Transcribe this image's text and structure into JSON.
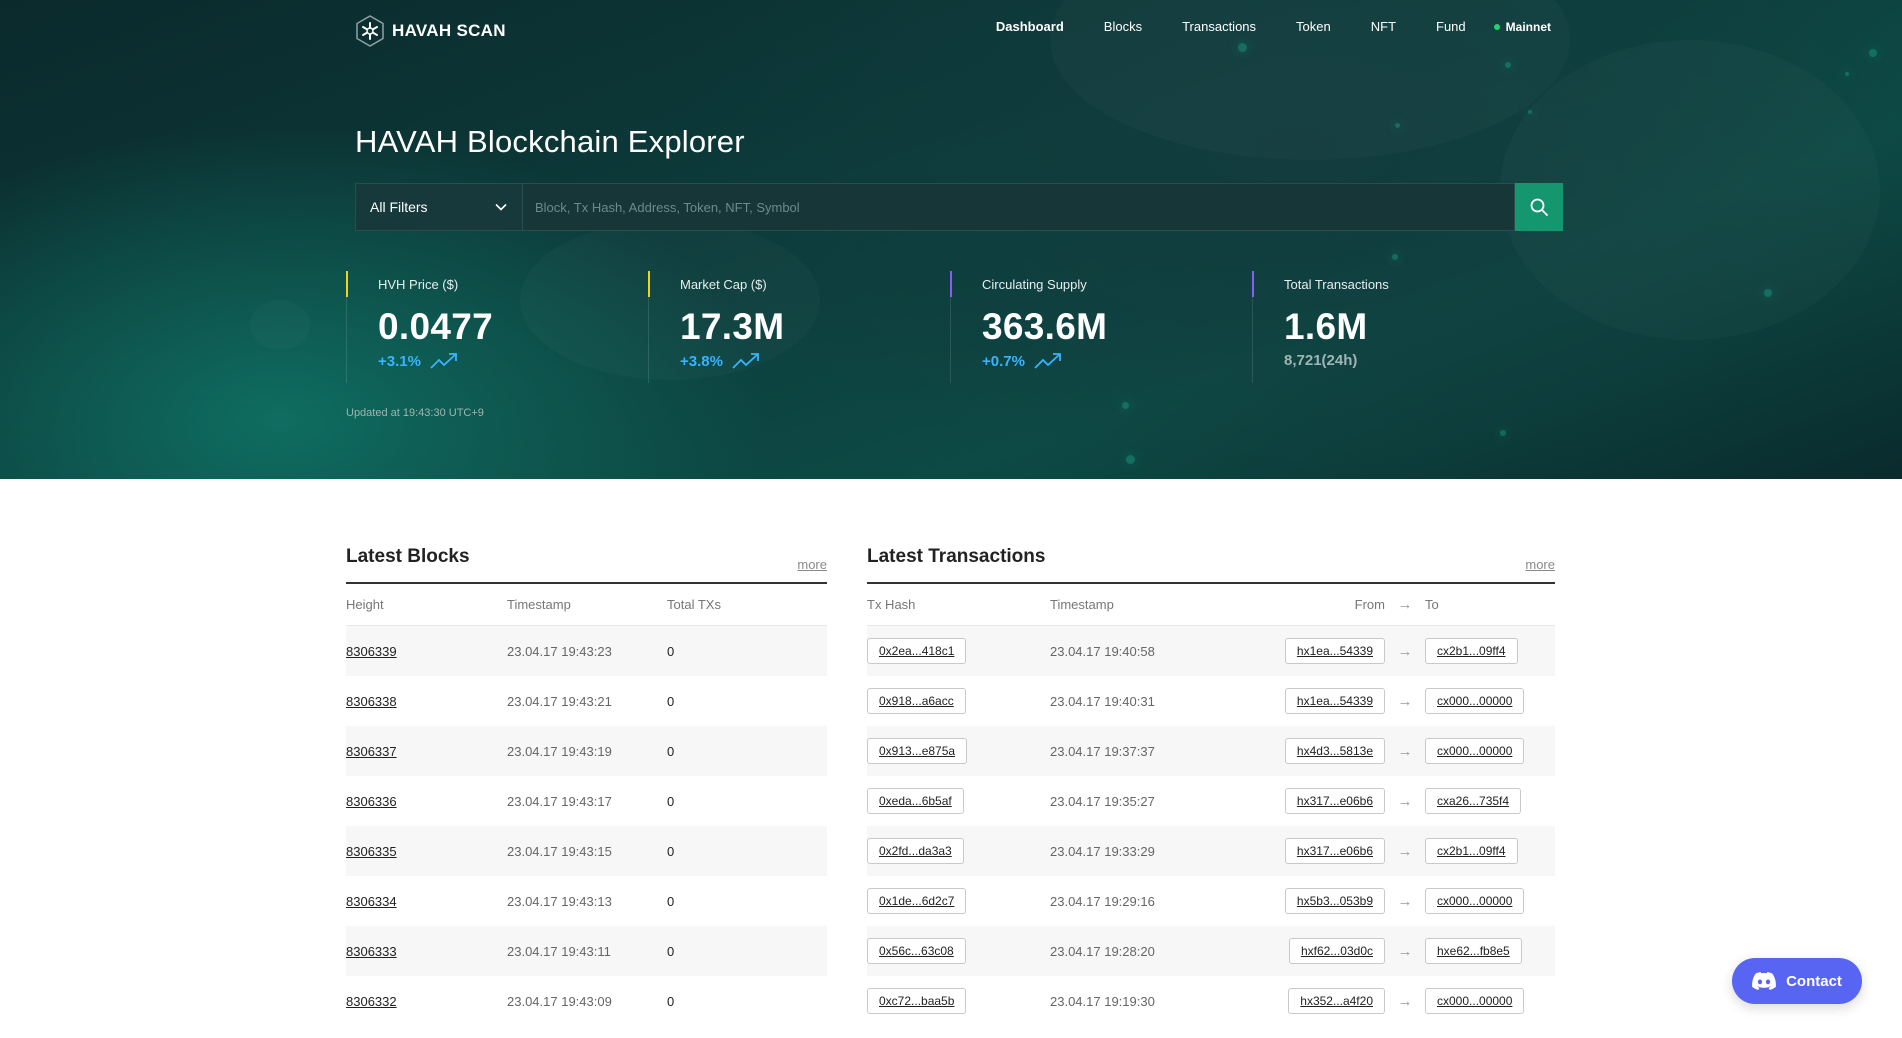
{
  "brand": {
    "logo_text": "HAVAH SCAN",
    "icon": "havah-logo-icon"
  },
  "nav": {
    "items": [
      {
        "label": "Dashboard",
        "active": true
      },
      {
        "label": "Blocks",
        "active": false
      },
      {
        "label": "Transactions",
        "active": false
      },
      {
        "label": "Token",
        "active": false
      },
      {
        "label": "NFT",
        "active": false
      },
      {
        "label": "Fund",
        "active": false
      }
    ],
    "network": "Mainnet",
    "network_color": "#22d36b"
  },
  "hero": {
    "title": "HAVAH Blockchain Explorer",
    "filter_label": "All Filters",
    "search_placeholder": "Block, Tx Hash, Address, Token, NFT, Symbol",
    "search_icon": "search-icon",
    "updated": "Updated at 19:43:30 UTC+9"
  },
  "stats": [
    {
      "label": "HVH Price ($)",
      "value": "0.0477",
      "change": "+3.1%",
      "accent": "#f2d21b"
    },
    {
      "label": "Market Cap ($)",
      "value": "17.3M",
      "change": "+3.8%",
      "accent": "#f2d21b"
    },
    {
      "label": "Circulating Supply",
      "value": "363.6M",
      "change": "+0.7%",
      "accent": "#8a5cf6"
    },
    {
      "label": "Total Transactions",
      "value": "1.6M",
      "sub": "8,721(24h)",
      "accent": "#8a5cf6"
    }
  ],
  "blocks": {
    "title": "Latest Blocks",
    "more": "more",
    "columns": [
      "Height",
      "Timestamp",
      "Total TXs"
    ],
    "rows": [
      {
        "height": "8306339",
        "timestamp": "23.04.17 19:43:23",
        "txs": "0"
      },
      {
        "height": "8306338",
        "timestamp": "23.04.17 19:43:21",
        "txs": "0"
      },
      {
        "height": "8306337",
        "timestamp": "23.04.17 19:43:19",
        "txs": "0"
      },
      {
        "height": "8306336",
        "timestamp": "23.04.17 19:43:17",
        "txs": "0"
      },
      {
        "height": "8306335",
        "timestamp": "23.04.17 19:43:15",
        "txs": "0"
      },
      {
        "height": "8306334",
        "timestamp": "23.04.17 19:43:13",
        "txs": "0"
      },
      {
        "height": "8306333",
        "timestamp": "23.04.17 19:43:11",
        "txs": "0"
      },
      {
        "height": "8306332",
        "timestamp": "23.04.17 19:43:09",
        "txs": "0"
      }
    ]
  },
  "transactions": {
    "title": "Latest Transactions",
    "more": "more",
    "columns": {
      "hash": "Tx Hash",
      "timestamp": "Timestamp",
      "from": "From",
      "arrow": "→",
      "to": "To"
    },
    "rows": [
      {
        "hash": "0x2ea...418c1",
        "timestamp": "23.04.17 19:40:58",
        "from": "hx1ea...54339",
        "to": "cx2b1...09ff4"
      },
      {
        "hash": "0x918...a6acc",
        "timestamp": "23.04.17 19:40:31",
        "from": "hx1ea...54339",
        "to": "cx000...00000"
      },
      {
        "hash": "0x913...e875a",
        "timestamp": "23.04.17 19:37:37",
        "from": "hx4d3...5813e",
        "to": "cx000...00000"
      },
      {
        "hash": "0xeda...6b5af",
        "timestamp": "23.04.17 19:35:27",
        "from": "hx317...e06b6",
        "to": "cxa26...735f4"
      },
      {
        "hash": "0x2fd...da3a3",
        "timestamp": "23.04.17 19:33:29",
        "from": "hx317...e06b6",
        "to": "cx2b1...09ff4"
      },
      {
        "hash": "0x1de...6d2c7",
        "timestamp": "23.04.17 19:29:16",
        "from": "hx5b3...053b9",
        "to": "cx000...00000"
      },
      {
        "hash": "0x56c...63c08",
        "timestamp": "23.04.17 19:28:20",
        "from": "hxf62...03d0c",
        "to": "hxe62...fb8e5"
      },
      {
        "hash": "0xc72...baa5b",
        "timestamp": "23.04.17 19:19:30",
        "from": "hx352...a4f20",
        "to": "cx000...00000"
      }
    ]
  },
  "contact": {
    "label": "Contact",
    "icon": "discord-icon",
    "color": "#5865f2"
  }
}
